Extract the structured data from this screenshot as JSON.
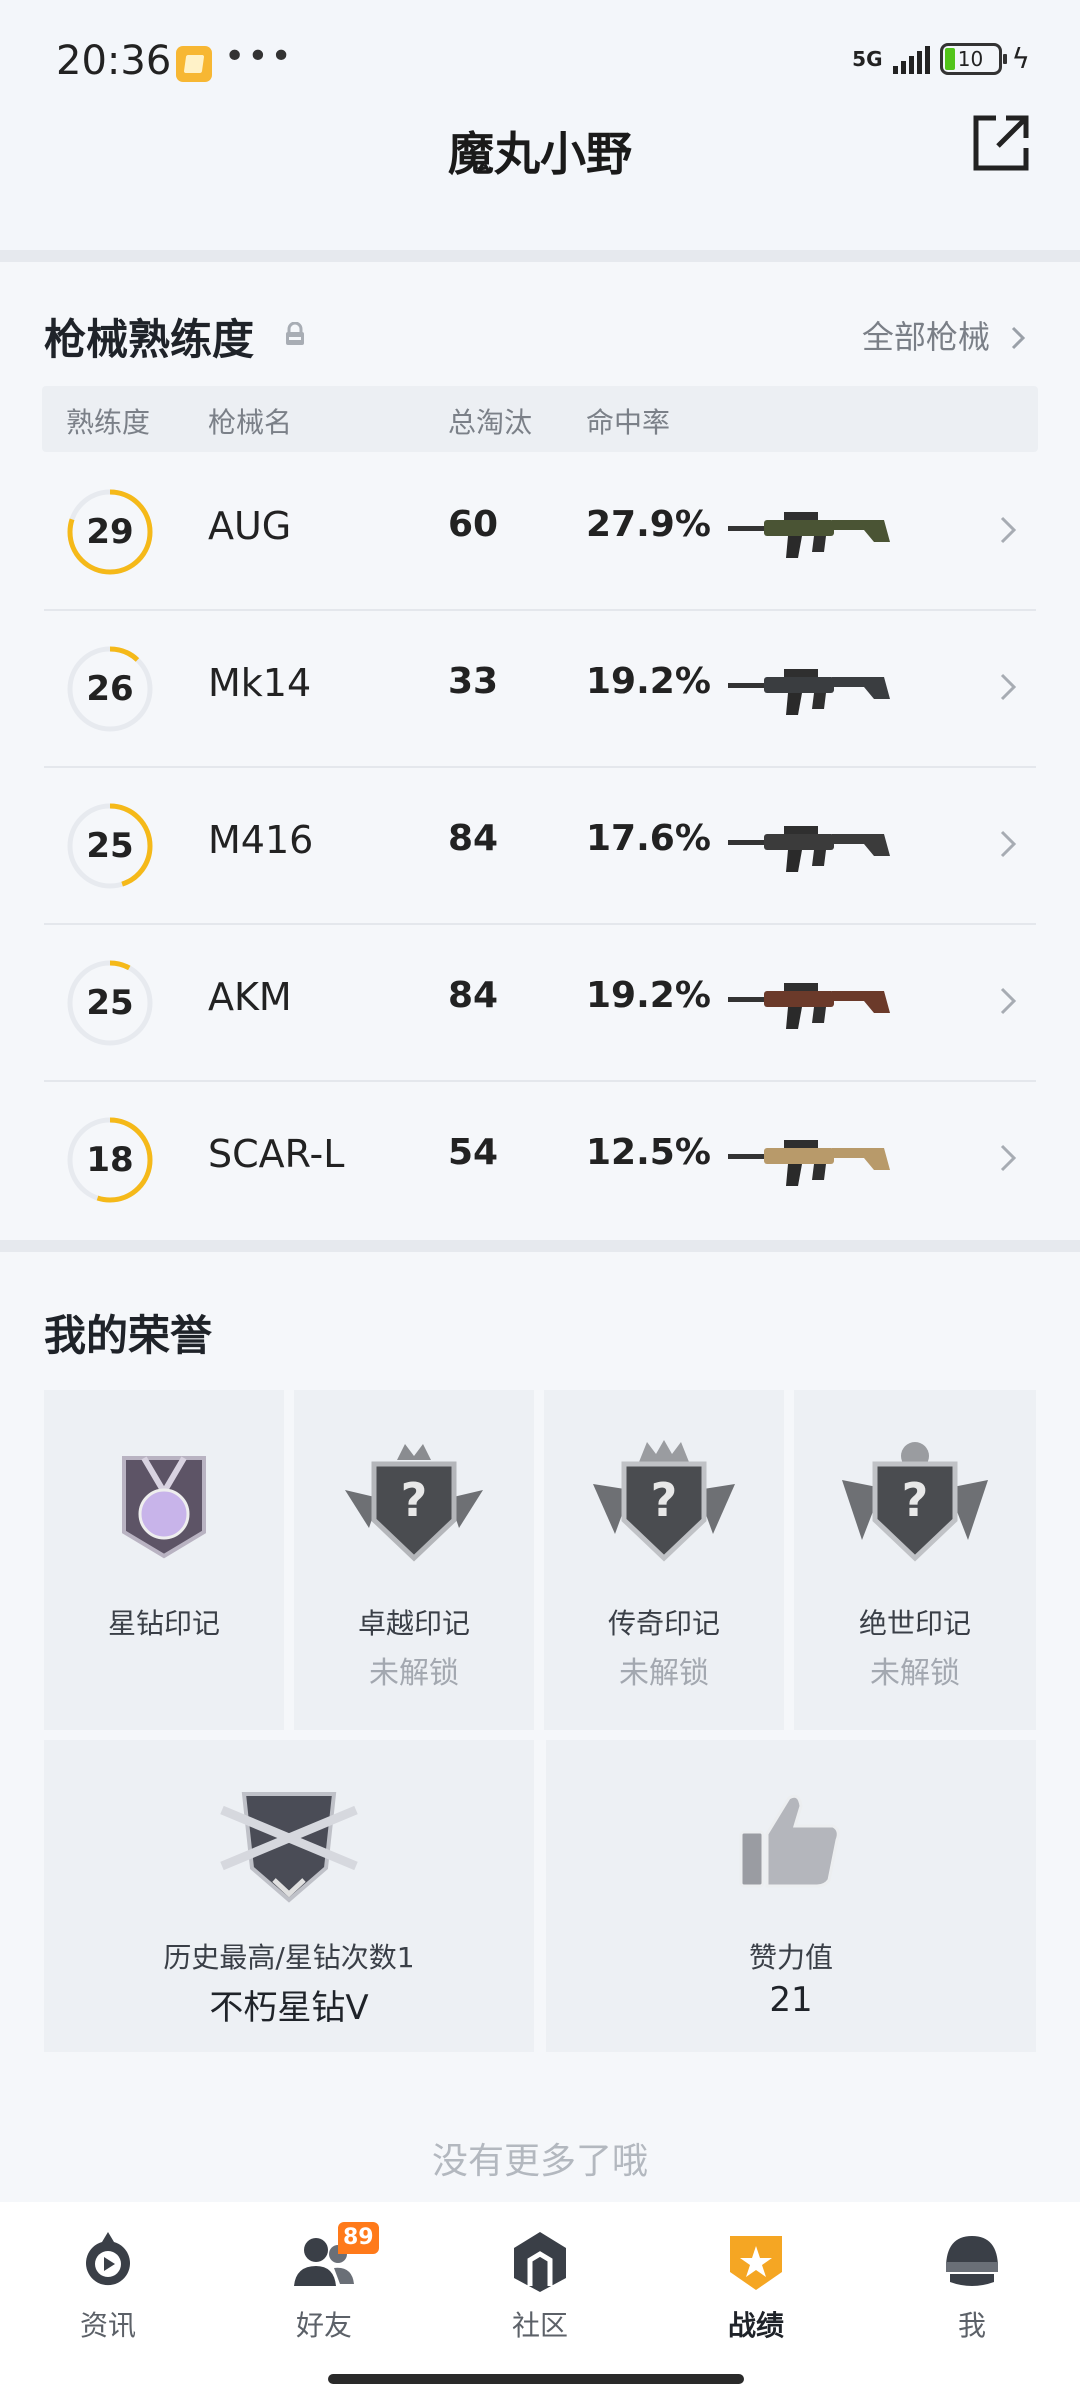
{
  "status_bar": {
    "time": "20:36",
    "dots": "•••",
    "network": "5G",
    "battery": "10",
    "charging_icon": "bolt-icon"
  },
  "header": {
    "title": "魔丸小野",
    "share_icon": "share-icon"
  },
  "weapons": {
    "section_title": "枪械熟练度",
    "all_link": "全部枪械",
    "columns": {
      "proficiency": "熟练度",
      "name": "枪械名",
      "kills": "总淘汰",
      "accuracy": "命中率"
    },
    "accent_color": "#f5b919",
    "rows": [
      {
        "level": "29",
        "name": "AUG",
        "kills": "60",
        "accuracy": "27.9%",
        "progress": 0.8,
        "gun_color": "#4a5434"
      },
      {
        "level": "26",
        "name": "Mk14",
        "kills": "33",
        "accuracy": "19.2%",
        "progress": 0.12,
        "gun_color": "#3a3d40"
      },
      {
        "level": "25",
        "name": "M416",
        "kills": "84",
        "accuracy": "17.6%",
        "progress": 0.45,
        "gun_color": "#3b3b3b"
      },
      {
        "level": "25",
        "name": "AKM",
        "kills": "84",
        "accuracy": "19.2%",
        "progress": 0.08,
        "gun_color": "#6b3a2a"
      },
      {
        "level": "18",
        "name": "SCAR-L",
        "kills": "54",
        "accuracy": "12.5%",
        "progress": 0.55,
        "gun_color": "#b89a6a"
      }
    ]
  },
  "honors": {
    "section_title": "我的荣誉",
    "badges": [
      {
        "label": "星钻印记",
        "status": ""
      },
      {
        "label": "卓越印记",
        "status": "未解锁"
      },
      {
        "label": "传奇印记",
        "status": "未解锁"
      },
      {
        "label": "绝世印记",
        "status": "未解锁"
      }
    ],
    "best": {
      "label": "历史最高/星钻次数1",
      "value": "不朽星钻V"
    },
    "likes": {
      "label": "赞力值",
      "value": "21"
    },
    "no_more": "没有更多了哦"
  },
  "nav": {
    "items": [
      {
        "label": "资讯",
        "icon": "news-icon"
      },
      {
        "label": "好友",
        "icon": "friends-icon",
        "badge": "89"
      },
      {
        "label": "社区",
        "icon": "community-icon"
      },
      {
        "label": "战绩",
        "icon": "record-icon",
        "active": true
      },
      {
        "label": "我",
        "icon": "profile-icon"
      }
    ]
  }
}
